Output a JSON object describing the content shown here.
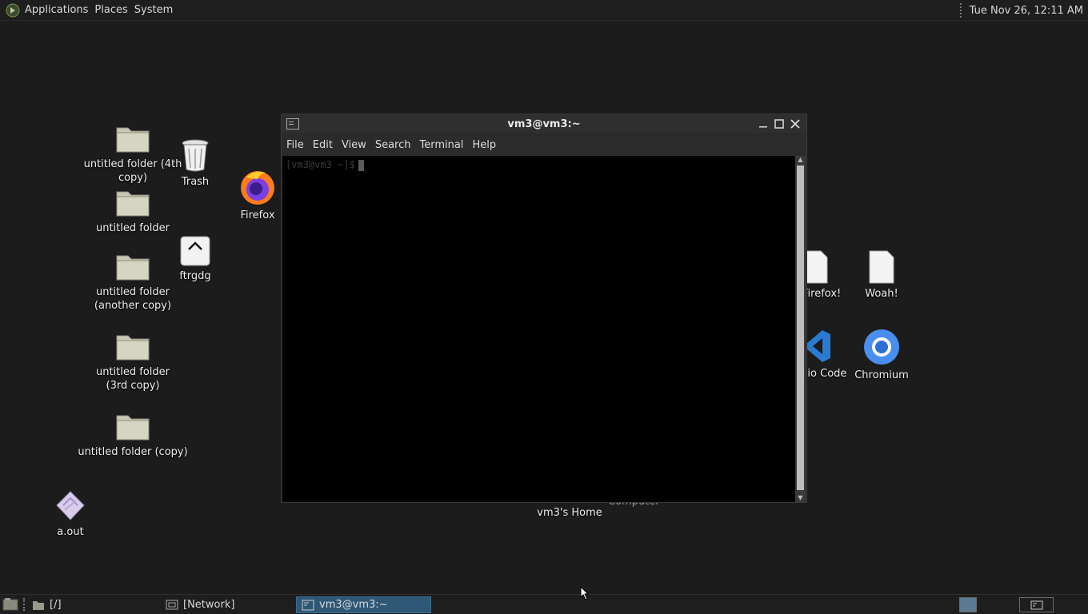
{
  "top_panel": {
    "menus": [
      "Applications",
      "Places",
      "System"
    ],
    "clock": "Tue Nov 26, 12:11 AM"
  },
  "desktop": {
    "icons": {
      "folder_4th": "untitled folder (4th copy)",
      "folder": "untitled folder",
      "folder_another": "untitled folder (another copy)",
      "folder_3rd": "untitled folder (3rd copy)",
      "folder_copy": "untitled folder (copy)",
      "aout": "a.out",
      "trash": "Trash",
      "ftrgdg": "ftrgdg",
      "firefox": "Firefox",
      "hello_firefox": "e, Firefox!",
      "woah": "Woah!",
      "vscode": "Studio Code",
      "chromium": "Chromium",
      "computer": "Computer",
      "home": "vm3's Home"
    }
  },
  "terminal": {
    "title": "vm3@vm3:~",
    "menu": [
      "File",
      "Edit",
      "View",
      "Search",
      "Terminal",
      "Help"
    ],
    "prompt": "[vm3@vm3 ~]$"
  },
  "taskbar": {
    "tasks": [
      "[/]",
      "[Network]",
      "vm3@vm3:~"
    ]
  },
  "colors": {
    "desktop_bg": "#1c1c1c",
    "active_task": "#2e5876",
    "vscode_blue": "#2a7bd0",
    "chromium_blue": "#4a8ef0"
  }
}
